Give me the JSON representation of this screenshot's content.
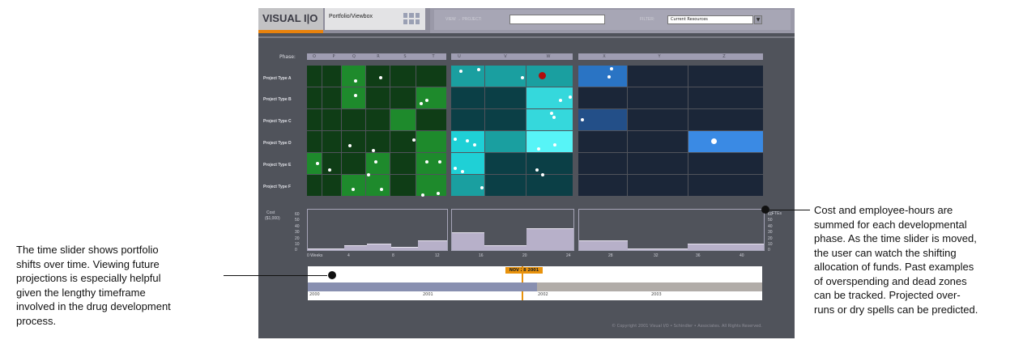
{
  "app": {
    "logo": "VISUAL I|O",
    "tab_label": "Portfolio/Viewbox",
    "view_label": "VIEW → PROJECT:",
    "view_value": "",
    "filter_label": "FILTER:",
    "filter_value": "Current Resources",
    "filter_arrow": "▼",
    "copyright": "© Copyright 2001 Visual I/O • Schindler • Associates. All Rights Reserved."
  },
  "matrix": {
    "phase_label": "Phase:",
    "phase_letters": [
      "O",
      "P",
      "Q",
      "R",
      "S",
      "T",
      "U",
      "V",
      "W",
      "X",
      "Y",
      "Z"
    ],
    "row_labels": [
      "Project Type A",
      "Project Type B",
      "Project Type C",
      "Project Type D",
      "Project Type E",
      "Project Type F"
    ]
  },
  "charts": {
    "left_label_1": "Cost",
    "left_label_2": "($1,000)",
    "right_label": "FTEs",
    "y_ticks": [
      "60",
      "50",
      "40",
      "30",
      "20",
      "10",
      "0"
    ],
    "x_ticks": [
      "0 Weeks",
      "4",
      "8",
      "12",
      "16",
      "20",
      "24",
      "28",
      "32",
      "36",
      "40"
    ]
  },
  "slider": {
    "date": "NOV 28 2001",
    "years": [
      "2000",
      "2001",
      "2002",
      "2003"
    ]
  },
  "callouts": {
    "left": [
      "The time slider shows portfolio",
      "shifts over time. Viewing future",
      "projections is especially helpful",
      "given the lengthy timeframe",
      "involved in the drug development",
      "process."
    ],
    "right": [
      "Cost and employee-hours are",
      "summed for each developmental",
      "phase. As the time slider is moved,",
      "the user can watch the shifting",
      "allocation of funds. Past examples",
      "of overspending and dead zones",
      "can be tracked. Projected over-",
      "runs or dry spells can be predicted."
    ]
  }
}
